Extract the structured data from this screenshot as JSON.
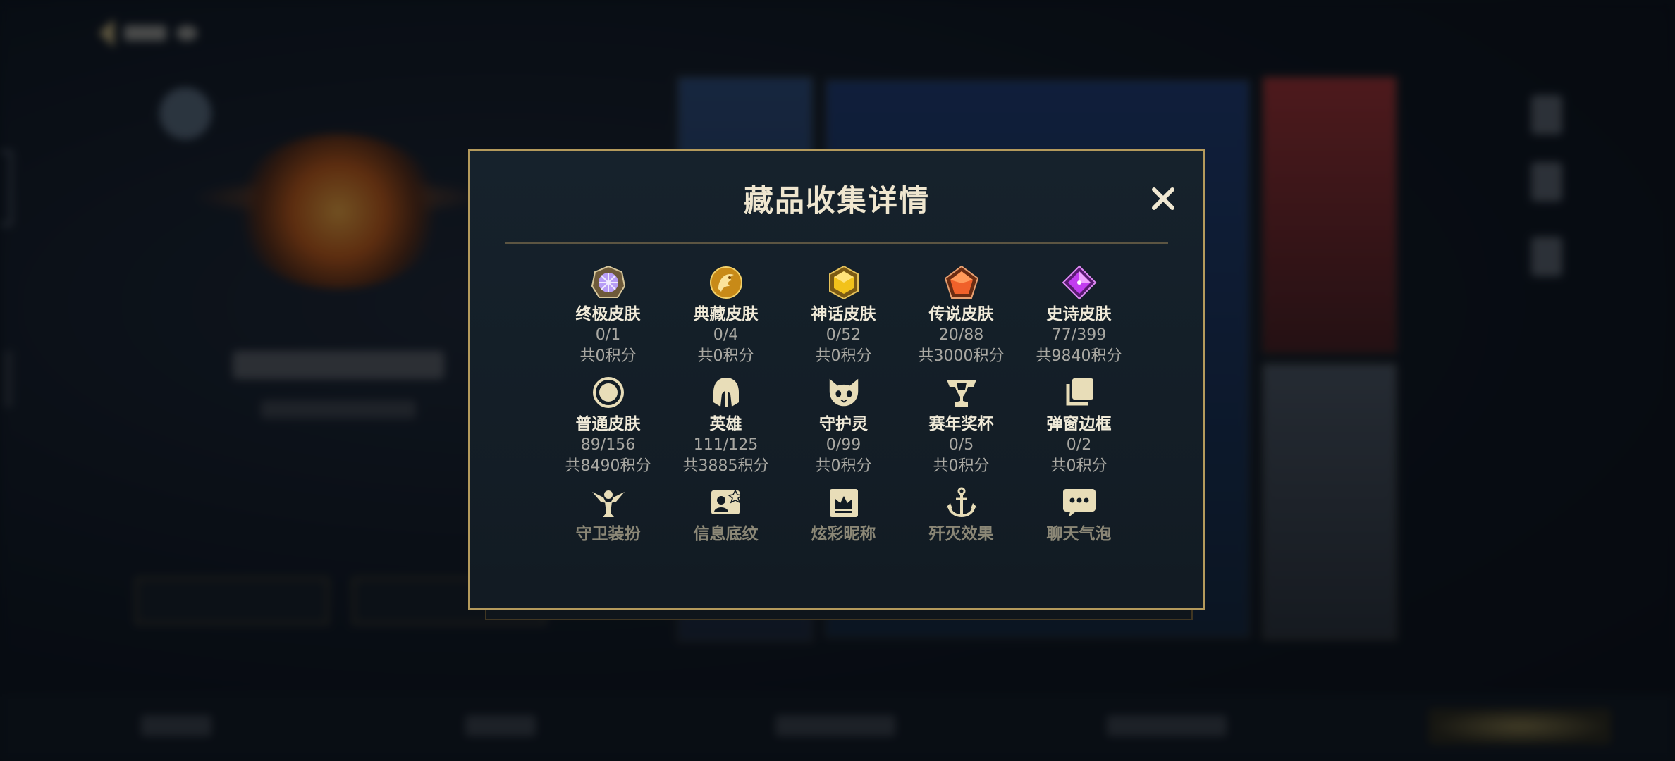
{
  "modal": {
    "title": "藏品收集详情",
    "close_icon": "close-icon",
    "categories": [
      {
        "icon": "ultimate-skin-gem-icon",
        "name": "终极皮肤",
        "count": "0/1",
        "points": "共0积分"
      },
      {
        "icon": "prestige-skin-dragon-icon",
        "name": "典藏皮肤",
        "count": "0/4",
        "points": "共0积分"
      },
      {
        "icon": "mythic-skin-gem-icon",
        "name": "神话皮肤",
        "count": "0/52",
        "points": "共0积分"
      },
      {
        "icon": "legendary-skin-gem-icon",
        "name": "传说皮肤",
        "count": "20/88",
        "points": "共3000积分"
      },
      {
        "icon": "epic-skin-gem-icon",
        "name": "史诗皮肤",
        "count": "77/399",
        "points": "共9840积分"
      },
      {
        "icon": "normal-skin-ring-icon",
        "name": "普通皮肤",
        "count": "89/156",
        "points": "共8490积分"
      },
      {
        "icon": "champion-helmet-icon",
        "name": "英雄",
        "count": "111/125",
        "points": "共3885积分"
      },
      {
        "icon": "guardian-spirit-icon",
        "name": "守护灵",
        "count": "0/99",
        "points": "共0积分"
      },
      {
        "icon": "season-trophy-icon",
        "name": "赛年奖杯",
        "count": "0/5",
        "points": "共0积分"
      },
      {
        "icon": "popup-frame-icon",
        "name": "弹窗边框",
        "count": "0/2",
        "points": "共0积分"
      },
      {
        "icon": "ward-skin-icon",
        "name": "守卫装扮"
      },
      {
        "icon": "profile-card-icon",
        "name": "信息底纹"
      },
      {
        "icon": "colorful-nickname-crown-icon",
        "name": "炫彩昵称"
      },
      {
        "icon": "ace-effect-anchor-icon",
        "name": "歼灭效果"
      },
      {
        "icon": "chat-bubble-icon",
        "name": "聊天气泡"
      }
    ]
  },
  "colors": {
    "gold_border": "#b49a5c",
    "title_text": "#efe6cf",
    "secondary_text": "#a9a8a2",
    "ultimate": "#b79cf5",
    "prestige": "#e4a82a",
    "mythic": "#f2c21b",
    "legendary": "#f0612a",
    "epic": "#c23cf0",
    "cream_icon": "#e8ddb8"
  }
}
